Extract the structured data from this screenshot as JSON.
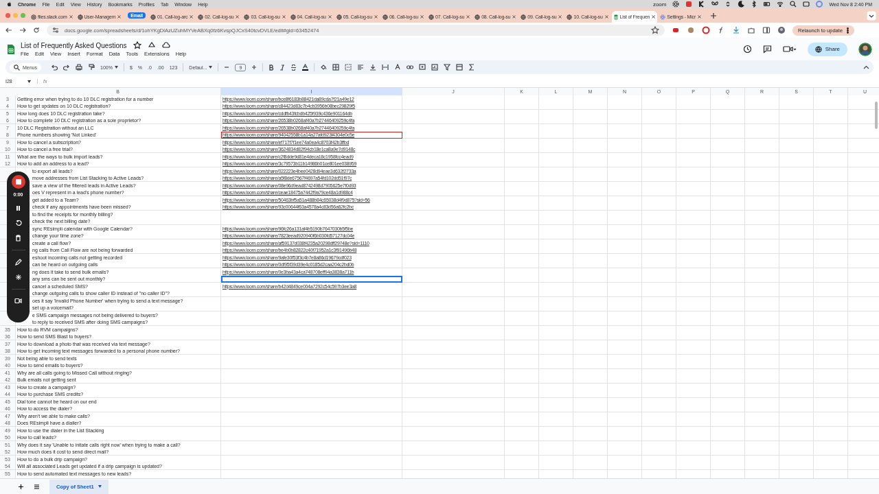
{
  "mac_menubar": {
    "app": "Chrome",
    "menus": [
      "File",
      "Edit",
      "View",
      "History",
      "Bookmarks",
      "Profiles",
      "Tab",
      "Window",
      "Help"
    ],
    "status_text": "zoom",
    "clock": "Wed Nov 8  2:40 PM"
  },
  "tabs": [
    {
      "kind": "file",
      "label": "files.slack.com",
      "selected": false
    },
    {
      "kind": "site",
      "label": "User-Managem",
      "selected": false
    },
    {
      "kind": "group",
      "label": "Email",
      "selected": false
    },
    {
      "kind": "site",
      "label": "01. Call-log-arc",
      "selected": false
    },
    {
      "kind": "site",
      "label": "02. Call-log-su",
      "selected": false
    },
    {
      "kind": "site",
      "label": "03. Call-log-su",
      "selected": false
    },
    {
      "kind": "site",
      "label": "04. Call-log-su",
      "selected": false
    },
    {
      "kind": "site",
      "label": "05. Call-log-su",
      "selected": false
    },
    {
      "kind": "site",
      "label": "06. Call-log-su",
      "selected": false
    },
    {
      "kind": "site",
      "label": "07. Call-log-su",
      "selected": false
    },
    {
      "kind": "site",
      "label": "08. Call-log-su",
      "selected": false
    },
    {
      "kind": "site",
      "label": "09. Call-log-su",
      "selected": false
    },
    {
      "kind": "site",
      "label": "10. Call-log-su",
      "selected": false
    },
    {
      "kind": "sheet",
      "label": "List of Frequen",
      "selected": true
    },
    {
      "kind": "settings",
      "label": "Settings - Micr",
      "selected": false
    }
  ],
  "address_bar": {
    "url": "docs.google.com/spreadsheets/d/1ohYKgDlAzUZuhMYVeABXq0fz6KvspQJCxS40tcvDVLE/edit#gid=63452474",
    "relaunch": "Relaunch to update"
  },
  "document": {
    "title": "List of Frequently Asked Questions",
    "menus": [
      "File",
      "Edit",
      "View",
      "Insert",
      "Format",
      "Data",
      "Tools",
      "Extensions",
      "Help"
    ],
    "share": "Share"
  },
  "toolbar": {
    "search": "Menus",
    "zoom": "100%",
    "currency": "$",
    "percent": "%",
    "decrease_decimals": ".0",
    "increase_decimals": ".00",
    "number_format": "123",
    "font": "Defaul...",
    "font_size": "9"
  },
  "formula_bar": {
    "cell": "I28",
    "fx": "fx"
  },
  "columns": [
    {
      "letter": "B",
      "selected": false
    },
    {
      "letter": "I",
      "selected": true
    },
    {
      "letter": "J",
      "selected": false
    },
    {
      "letter": "K",
      "selected": false
    },
    {
      "letter": "L",
      "selected": false
    },
    {
      "letter": "M",
      "selected": false
    },
    {
      "letter": "N",
      "selected": false
    },
    {
      "letter": "O",
      "selected": false
    },
    {
      "letter": "P",
      "selected": false
    },
    {
      "letter": "Q",
      "selected": false
    },
    {
      "letter": "R",
      "selected": false
    },
    {
      "letter": "S",
      "selected": false
    },
    {
      "letter": "T",
      "selected": false
    },
    {
      "letter": "U",
      "selected": false
    }
  ],
  "rows": [
    {
      "number": "3",
      "question": "Getting error when trying to do 10 DLC registration for a number",
      "link": "https://www.loom.com/share/bce8f6183b88421da89cda7f21a49e12",
      "selected": false,
      "collaborator": false
    },
    {
      "number": "4",
      "question": "How to get updates on 10 DLC registration?",
      "link": "https://www.loom.com/share/c84423d83c7b4cb3956b08bec29829f5",
      "selected": false,
      "collaborator": false
    },
    {
      "number": "5",
      "question": "How long does 10 DLC registration take?",
      "link": "https://www.loom.com/share/cddfb43fcbdb425f939c436e901164db",
      "selected": false,
      "collaborator": false
    },
    {
      "number": "6",
      "question": "How to complete 10 DLC registration as a sole proprietor?",
      "link": "https://www.loom.com/share/26538b0268af40a7b27446409259c4fa",
      "selected": false,
      "collaborator": false
    },
    {
      "number": "7",
      "question": "10 DLC Registration without an LLC",
      "link": "https://www.loom.com/share/26538b0268af40a7b27446409259c4fa",
      "selected": false,
      "collaborator": false
    },
    {
      "number": "8",
      "question": "Phone numbers showing 'Not Linked'",
      "link": "https://www.loom.com/share/94042558b1a14a27afd923f4304e0c5e",
      "selected": false,
      "collaborator": true
    },
    {
      "number": "9",
      "question": "How to cancel a subscription?",
      "link": "https://www.loom.com/share/ef717f7f1ee74a0ea4c8703f42b3ffbd",
      "selected": false,
      "collaborator": false
    },
    {
      "number": "10",
      "question": "How to cancel a free trial?",
      "link": "https://www.loom.com/share/3624834d82f94cb18e1ca8a9e7d9148c",
      "selected": false,
      "collaborator": false
    },
    {
      "number": "11",
      "question": "What are the ways to bulk import leads?",
      "link": "https://www.loom.com/share/c2f8dde9d81e4deca18c1958fcc4ead9",
      "selected": false,
      "collaborator": false
    },
    {
      "number": "12",
      "question": "How to add an address to a lead?",
      "link": "https://www.loom.com/share/3c79573b11b14986b01ce801ee038959",
      "selected": false,
      "collaborator": false
    },
    {
      "question": "to export all leads?",
      "link": "https://www.loom.com/share/022223e4bee0428d94eae3d632f2733a",
      "selected": false,
      "collaborator": false
    },
    {
      "question": "move addresses from List Stacking to Active Leads?",
      "link": "https://www.loom.com/share/a5f8de67567f4697a54fd102dd51f97c",
      "selected": false,
      "collaborator": false
    },
    {
      "question": "save a view of the filtered leads in Active Leads?",
      "link": "https://www.loom.com/share/08e96d9ead8742498d7905625e7f0d93",
      "selected": false,
      "collaborator": false
    },
    {
      "question": "oes V represent in a lead's phone number?",
      "link": "https://www.loom.com/share/ceae18475a7442f9a79ce48a1d988c4",
      "selected": false,
      "collaborator": false
    },
    {
      "question": "get added to a Team?",
      "link": "https://www.loom.com/share/50463bf5a51a488b84c65038d4f9d875?sid=56",
      "selected": false,
      "collaborator": false
    },
    {
      "question": "check if any appointments have been missed?",
      "link": "https://www.loom.com/share/93c00644f63a4578a4c83d56a62fc2bc",
      "selected": false,
      "collaborator": false
    },
    {
      "question": "to find the receipts for monthly billing?",
      "selected": false,
      "collaborator": false
    },
    {
      "question": "check the next billing date?",
      "selected": false,
      "collaborator": false
    },
    {
      "question": "sync REsimpli calendar with Google Calendar?",
      "link": "https://www.loom.com/share/96fc26a131af4b5190b7647030b5f5be",
      "selected": false,
      "collaborator": false
    },
    {
      "question": "change your time zone?",
      "link": "https://www.loom.com/share/7823eead920940f6b030fd57127dc04e",
      "selected": false,
      "collaborator": false
    },
    {
      "question": "create a call flow?",
      "link": "https://www.loom.com/share/af59137d038f4235a20298dff29748e?sid=1110",
      "selected": false,
      "collaborator": false
    },
    {
      "question": "ng calls from Call Flow are not being forwarded",
      "link": "https://www.loom.com/share/be4b0b82822c40f71952a1c3f91496b48",
      "selected": false,
      "collaborator": false
    },
    {
      "question": "eshoot incoming calls not getting recorded",
      "link": "https://www.loom.com/share/9afe30f53f3c4b7e8a86d19679cdf023",
      "selected": false,
      "collaborator": false
    },
    {
      "question": "can be heard on outgoing calls",
      "link": "https://www.loom.com/share/0df95f39d39e4c0185d2caa204c2bd0b",
      "selected": false,
      "collaborator": false
    },
    {
      "question": "ng does it take to send bulk emails?",
      "link": "https://www.loom.com/share/0e3ba43a4ca748708eff94a3838a711b",
      "selected": false,
      "collaborator": false
    },
    {
      "question": "any sms can be sent out monthly?",
      "selected": true,
      "collaborator": false
    },
    {
      "question": "cancel a scheduled SMS?",
      "link": "https://www.loom.com/share/b42d4849ce004a7292c54c597b3ee3a8",
      "selected": false,
      "collaborator": false
    },
    {
      "question": "change outgoing calls to show caller ID instead of  \"no caller ID\"?",
      "selected": false,
      "collaborator": false
    },
    {
      "question": "oes it say 'Invalid Phone Number' when trying to send a text message?",
      "selected": false,
      "collaborator": false
    },
    {
      "question": "set up a voicemail?",
      "selected": false,
      "collaborator": false
    },
    {
      "question": "e SMS campaign messages not being delivered to buyers?",
      "selected": false,
      "collaborator": false
    },
    {
      "question": "to reply to received SMS after doing SMS campaigns?",
      "selected": false,
      "collaborator": false
    },
    {
      "number": "35",
      "question": "How to do RVM campaigns?",
      "selected": false,
      "collaborator": false
    },
    {
      "number": "36",
      "question": "How to send SMS Blast to buyers?",
      "selected": false,
      "collaborator": false
    },
    {
      "number": "37",
      "question": "How to download a photo that was received via text message?",
      "selected": false,
      "collaborator": false
    },
    {
      "number": "38",
      "question": "How to get incoming text messages forwarded to a personal phone number?",
      "selected": false,
      "collaborator": false
    },
    {
      "number": "39",
      "question": "Not being able to send texts",
      "selected": false,
      "collaborator": false
    },
    {
      "number": "40",
      "question": "How to send emails to buyers?",
      "selected": false,
      "collaborator": false
    },
    {
      "number": "41",
      "question": "Why are all calls going to Missed Call without ringing?",
      "selected": false,
      "collaborator": false
    },
    {
      "number": "42",
      "question": "Bulk emails not getting sent",
      "selected": false,
      "collaborator": false
    },
    {
      "number": "43",
      "question": "How to create a campaign?",
      "selected": false,
      "collaborator": false
    },
    {
      "number": "44",
      "question": "How to purchase SMS credits?",
      "selected": false,
      "collaborator": false
    },
    {
      "number": "45",
      "question": "Dial tone cannot be heard on our end",
      "selected": false,
      "collaborator": false
    },
    {
      "number": "46",
      "question": "How to access the dialer?",
      "selected": false,
      "collaborator": false
    },
    {
      "number": "47",
      "question": "Why aren't we able to make calls?",
      "selected": false,
      "collaborator": false
    },
    {
      "number": "48",
      "question": "Does REsimpli have a dialler?",
      "selected": false,
      "collaborator": false
    },
    {
      "number": "49",
      "question": "How to use the dialer in the List Stacking",
      "selected": false,
      "collaborator": false
    },
    {
      "number": "50",
      "question": "How to call leads?",
      "selected": false,
      "collaborator": false
    },
    {
      "number": "51",
      "question": "Why does it say 'Unable to initate calls right now' when trying to make a call?",
      "selected": false,
      "collaborator": false
    },
    {
      "number": "52",
      "question": "How much does it cost to send direct mail?",
      "selected": false,
      "collaborator": false
    },
    {
      "number": "53",
      "question": "How to do a bulk drip campaign?",
      "selected": false,
      "collaborator": false
    },
    {
      "number": "54",
      "question": "Will all associated Leads get updated if a drip campaign is updated?",
      "selected": false,
      "collaborator": false
    },
    {
      "number": "55",
      "question": "How to send automated text messages to new leads?",
      "selected": false,
      "collaborator": false
    }
  ],
  "recorder": {
    "time": "0:00"
  },
  "sheet_tabs": [
    {
      "label": "Copy of Sheet1",
      "selected": true
    }
  ]
}
